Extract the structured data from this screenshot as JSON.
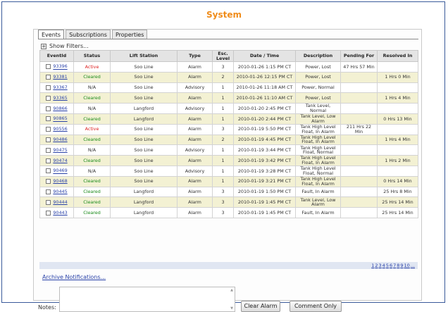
{
  "page": {
    "title": "System"
  },
  "tabs": [
    {
      "label": "Events",
      "active": true
    },
    {
      "label": "Subscriptions",
      "active": false
    },
    {
      "label": "Properties",
      "active": false
    }
  ],
  "filters": {
    "toggle": "+",
    "label": "Show Filters..."
  },
  "table": {
    "headers": [
      "EventId",
      "Status",
      "Lift Station",
      "Type",
      "Esc. Level",
      "Date / Time",
      "Description",
      "Pending For",
      "Resolved In"
    ],
    "rows": [
      {
        "id": "93396",
        "status": "Active",
        "station": "Soo Line",
        "type": "Alarm",
        "level": "3",
        "datetime": "2010-01-26 1:15 PM CT",
        "description": "Power, Lost",
        "pending": "47 Hrs 57 Min",
        "resolved": ""
      },
      {
        "id": "93381",
        "status": "Cleared",
        "station": "Soo Line",
        "type": "Alarm",
        "level": "2",
        "datetime": "2010-01-26 12:15 PM CT",
        "description": "Power, Lost",
        "pending": "",
        "resolved": "1 Hrs 0 Min"
      },
      {
        "id": "93367",
        "status": "N/A",
        "station": "Soo Line",
        "type": "Advisory",
        "level": "1",
        "datetime": "2010-01-26 11:18 AM CT",
        "description": "Power, Normal",
        "pending": "",
        "resolved": ""
      },
      {
        "id": "93365",
        "status": "Cleared",
        "station": "Soo Line",
        "type": "Alarm",
        "level": "1",
        "datetime": "2010-01-26 11:10 AM CT",
        "description": "Power, Lost",
        "pending": "",
        "resolved": "1 Hrs 4 Min"
      },
      {
        "id": "90866",
        "status": "N/A",
        "station": "Langford",
        "type": "Advisory",
        "level": "1",
        "datetime": "2010-01-20 2:45 PM CT",
        "description": "Tank Level, Normal",
        "pending": "",
        "resolved": ""
      },
      {
        "id": "90865",
        "status": "Cleared",
        "station": "Langford",
        "type": "Alarm",
        "level": "1",
        "datetime": "2010-01-20 2:44 PM CT",
        "description": "Tank Level, Low Alarm",
        "pending": "",
        "resolved": "0 Hrs 13 Min"
      },
      {
        "id": "90556",
        "status": "Active",
        "station": "Soo Line",
        "type": "Alarm",
        "level": "3",
        "datetime": "2010-01-19 5:50 PM CT",
        "description": "Tank High Level Float, In Alarm",
        "pending": "211 Hrs 22 Min",
        "resolved": ""
      },
      {
        "id": "90486",
        "status": "Cleared",
        "station": "Soo Line",
        "type": "Alarm",
        "level": "2",
        "datetime": "2010-01-19 4:45 PM CT",
        "description": "Tank High Level Float, In Alarm",
        "pending": "",
        "resolved": "1 Hrs 4 Min"
      },
      {
        "id": "90475",
        "status": "N/A",
        "station": "Soo Line",
        "type": "Advisory",
        "level": "1",
        "datetime": "2010-01-19 3:44 PM CT",
        "description": "Tank High Level Float, Normal",
        "pending": "",
        "resolved": ""
      },
      {
        "id": "90474",
        "status": "Cleared",
        "station": "Soo Line",
        "type": "Alarm",
        "level": "1",
        "datetime": "2010-01-19 3:42 PM CT",
        "description": "Tank High Level Float, In Alarm",
        "pending": "",
        "resolved": "1 Hrs 2 Min"
      },
      {
        "id": "90469",
        "status": "N/A",
        "station": "Soo Line",
        "type": "Advisory",
        "level": "1",
        "datetime": "2010-01-19 3:28 PM CT",
        "description": "Tank High Level Float, Normal",
        "pending": "",
        "resolved": ""
      },
      {
        "id": "90468",
        "status": "Cleared",
        "station": "Soo Line",
        "type": "Alarm",
        "level": "1",
        "datetime": "2010-01-19 3:21 PM CT",
        "description": "Tank High Level Float, In Alarm",
        "pending": "",
        "resolved": "0 Hrs 14 Min"
      },
      {
        "id": "90445",
        "status": "Cleared",
        "station": "Langford",
        "type": "Alarm",
        "level": "3",
        "datetime": "2010-01-19 1:50 PM CT",
        "description": "Fault, In Alarm",
        "pending": "",
        "resolved": "25 Hrs 8 Min"
      },
      {
        "id": "90444",
        "status": "Cleared",
        "station": "Langford",
        "type": "Alarm",
        "level": "3",
        "datetime": "2010-01-19 1:45 PM CT",
        "description": "Tank Level, Low Alarm",
        "pending": "",
        "resolved": "25 Hrs 14 Min"
      },
      {
        "id": "90443",
        "status": "Cleared",
        "station": "Langford",
        "type": "Alarm",
        "level": "3",
        "datetime": "2010-01-19 1:45 PM CT",
        "description": "Fault, In Alarm",
        "pending": "",
        "resolved": "25 Hrs 14 Min"
      }
    ]
  },
  "pager": {
    "pages": [
      "1",
      "2",
      "3",
      "4",
      "5",
      "6",
      "7",
      "8",
      "9",
      "10",
      "..."
    ]
  },
  "archive": {
    "label": "Archive Notifications..."
  },
  "notes": {
    "label": "Notes:",
    "value": ""
  },
  "buttons": {
    "clear_alarm": "Clear Alarm",
    "comment_only": "Comment Only"
  },
  "colors": {
    "title": "#f08c1a",
    "link": "#2a42a8",
    "active_status": "#dd2222",
    "cleared_status": "#1a8a1a",
    "alt_row": "#f3f1d3"
  }
}
